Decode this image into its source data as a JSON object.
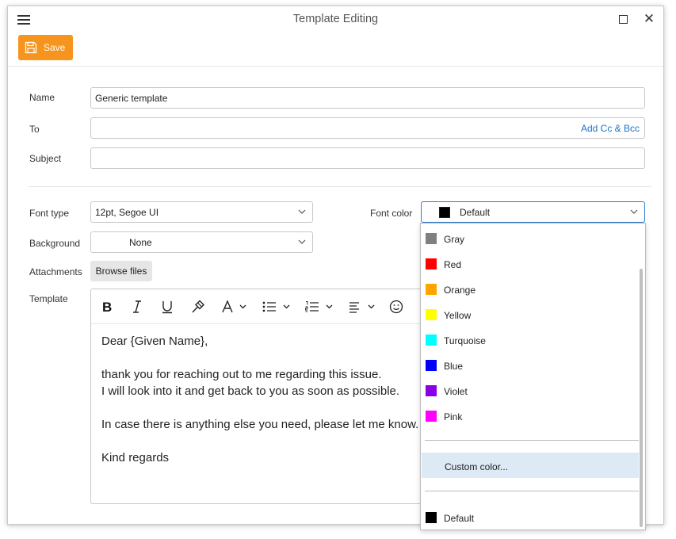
{
  "window": {
    "title": "Template Editing",
    "close_glyph": "✕"
  },
  "toolbar": {
    "save_label": "Save"
  },
  "form": {
    "name_label": "Name",
    "name_value": "Generic template",
    "to_label": "To",
    "to_value": "",
    "add_cc_bcc": "Add Cc & Bcc",
    "subject_label": "Subject",
    "subject_value": "",
    "font_type_label": "Font type",
    "font_type_value": "12pt, Segoe UI",
    "font_color_label": "Font color",
    "font_color_value": "Default",
    "background_label": "Background",
    "background_value": "None",
    "attachments_label": "Attachments",
    "browse_label": "Browse files",
    "template_label": "Template"
  },
  "editor": {
    "lines": [
      "Dear {Given Name},",
      "",
      "thank you for reaching out to me regarding this issue.",
      "I will look into it and get back to you as soon as possible.",
      "",
      "In case there is anything else you need, please let me know.",
      "",
      "Kind regards"
    ]
  },
  "color_dropdown": {
    "options": [
      {
        "label": "Gray",
        "color": "#808080"
      },
      {
        "label": "Red",
        "color": "#ff0000"
      },
      {
        "label": "Orange",
        "color": "#ffa500"
      },
      {
        "label": "Yellow",
        "color": "#ffff00"
      },
      {
        "label": "Turquoise",
        "color": "#00ffff"
      },
      {
        "label": "Blue",
        "color": "#0000ff"
      },
      {
        "label": "Violet",
        "color": "#8a00e6"
      },
      {
        "label": "Pink",
        "color": "#ff00ff"
      }
    ],
    "custom_label": "Custom color...",
    "default_label": "Default",
    "default_color": "#000000"
  },
  "colors": {
    "accent": "#f7941d",
    "link": "#1a73c9",
    "highlight": "#dde9f5",
    "focus": "#2e7bcf"
  }
}
